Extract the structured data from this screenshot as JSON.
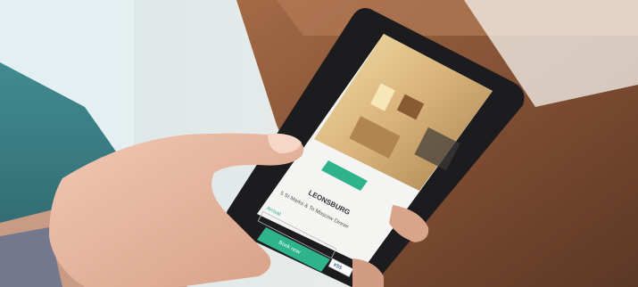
{
  "scene": {
    "description_tag": "photo",
    "colors": {
      "accent_green": "#2fb38a",
      "phone_body": "#1c1c1f",
      "wall_beige": "#e9d8ad",
      "table_wood": "#8c5a3c",
      "skin": "#e7b7a0"
    }
  },
  "phone_screen": {
    "hotel_name": "LEONSBURG",
    "subtitle": "5 St Marks & To Moscow Dinner",
    "book_button_label": "Book now",
    "price_label": "¥$$",
    "field_label": "Arrival"
  }
}
